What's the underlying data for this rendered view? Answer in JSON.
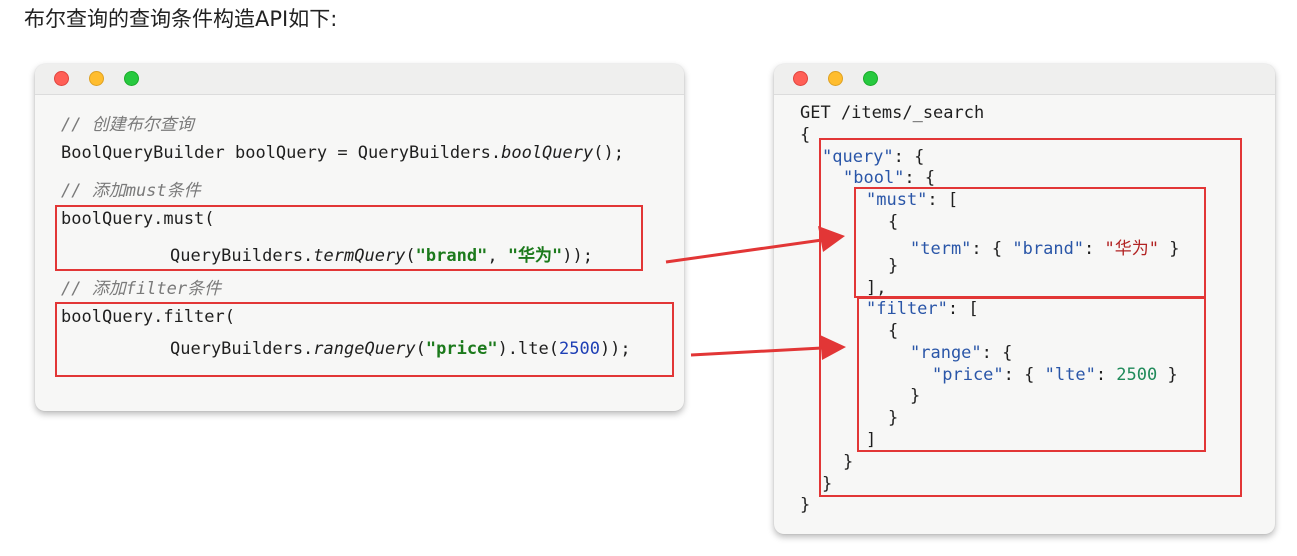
{
  "heading": "布尔查询的查询条件构造API如下:",
  "java_code": {
    "comment_create": "// 创建布尔查询",
    "line_builder_a": "BoolQueryBuilder boolQuery = QueryBuilders.",
    "line_builder_method": "boolQuery",
    "line_builder_b": "();",
    "comment_must": "// 添加must条件",
    "must_call": "boolQuery.must(",
    "must_qb": "QueryBuilders.",
    "must_method": "termQuery",
    "must_open": "(",
    "must_field": "\"brand\"",
    "must_sep": ", ",
    "must_value": "\"华为\"",
    "must_close": "));",
    "comment_filter": "// 添加filter条件",
    "filter_call": "boolQuery.filter(",
    "filter_qb": "QueryBuilders.",
    "filter_method": "rangeQuery",
    "filter_open": "(",
    "filter_field": "\"price\"",
    "filter_mid": ").lte(",
    "filter_value": "2500",
    "filter_close": "));"
  },
  "json_code": {
    "request_line": "GET /items/_search",
    "open_brace": "{",
    "query_key": "\"query\"",
    "bool_key": "\"bool\"",
    "must_key": "\"must\"",
    "term_key": "\"term\"",
    "brand_key": "\"brand\"",
    "brand_value": "\"华为\"",
    "filter_key": "\"filter\"",
    "range_key": "\"range\"",
    "price_key": "\"price\"",
    "lte_key": "\"lte\"",
    "lte_value": "2500",
    "colon_obj": ": {",
    "colon_arr": ": [",
    "close_brace": "}",
    "close_arr": "]",
    "close_arr_comma": "],"
  },
  "colors": {
    "highlight_box": "#e23636",
    "arrow": "#e23636",
    "json_key": "#2a56a8",
    "json_string": "#b22222",
    "json_number": "#1f8a5a",
    "java_string": "#1c7a1c"
  }
}
